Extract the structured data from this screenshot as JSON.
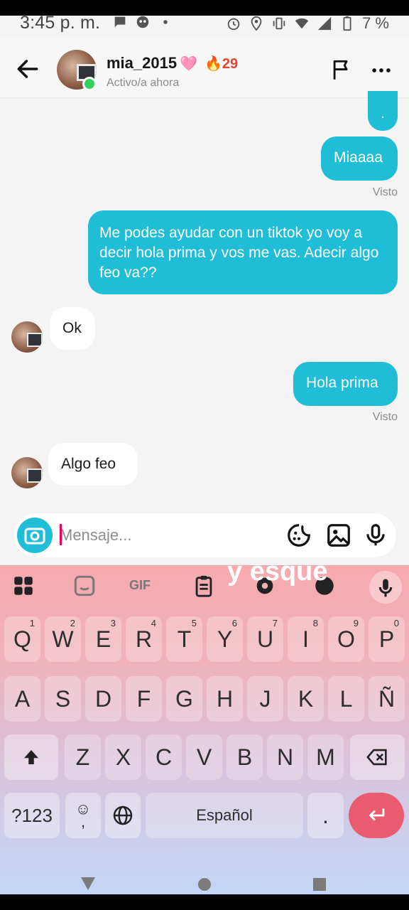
{
  "status_bar": {
    "time": "3:45 p. m.",
    "battery": "7 %"
  },
  "header": {
    "username": "mia_2015",
    "heart": "🩷",
    "streak_icon": "🔥",
    "streak_count": "29",
    "status": "Activo/a ahora"
  },
  "messages": [
    {
      "id": "m0",
      "side": "out",
      "text": "."
    },
    {
      "id": "m1",
      "side": "out",
      "text": "Miaaaa"
    },
    {
      "id": "s1",
      "type": "seen",
      "text": "Visto"
    },
    {
      "id": "m2",
      "side": "out",
      "text": "Me podes ayudar con un tiktok yo  voy a decir hola prima y vos me vas. Adecir algo feo va??"
    },
    {
      "id": "m3",
      "side": "in",
      "text": "Ok"
    },
    {
      "id": "m4",
      "side": "out",
      "text": "Hola prima"
    },
    {
      "id": "s2",
      "type": "seen",
      "text": "Visto"
    },
    {
      "id": "m5",
      "side": "in",
      "text": "Algo feo"
    }
  ],
  "composer": {
    "placeholder": "Mensaje..."
  },
  "overlay_caption": "y esque",
  "keyboard": {
    "gif_label": "GIF",
    "row1": [
      {
        "k": "Q",
        "h": "1"
      },
      {
        "k": "W",
        "h": "2"
      },
      {
        "k": "E",
        "h": "3"
      },
      {
        "k": "R",
        "h": "4"
      },
      {
        "k": "T",
        "h": "5"
      },
      {
        "k": "Y",
        "h": "6"
      },
      {
        "k": "U",
        "h": "7"
      },
      {
        "k": "I",
        "h": "8"
      },
      {
        "k": "O",
        "h": "9"
      },
      {
        "k": "P",
        "h": "0"
      }
    ],
    "row2": [
      "A",
      "S",
      "D",
      "F",
      "G",
      "H",
      "J",
      "K",
      "L",
      "Ñ"
    ],
    "row3": [
      "Z",
      "X",
      "C",
      "V",
      "B",
      "N",
      "M"
    ],
    "symbols_label": "?123",
    "emoji_comma": ",",
    "space_label": "Español",
    "period": "."
  },
  "colors": {
    "accent": "#1fbed6",
    "online": "#2fd35b",
    "streak": "#e2452d",
    "enter_key": "#e95b6e"
  }
}
